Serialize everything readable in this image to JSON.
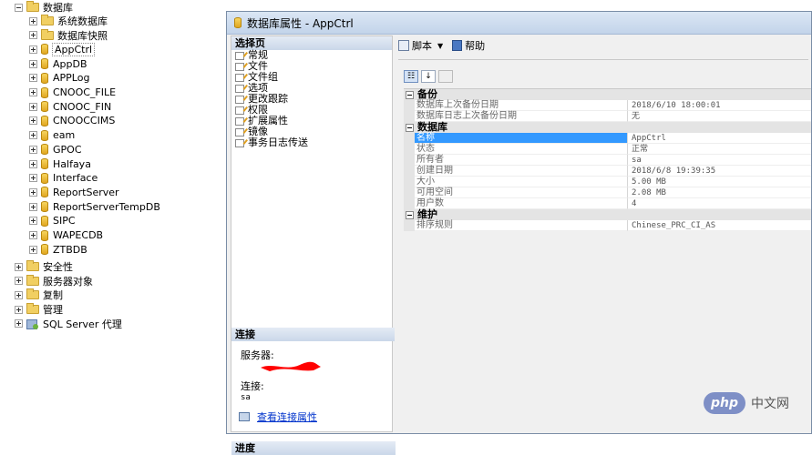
{
  "tree": {
    "root": {
      "label": "数据库",
      "expanded": true
    },
    "children": [
      {
        "label": "系统数据库",
        "icon": "folder-icon"
      },
      {
        "label": "数据库快照",
        "icon": "folder-icon"
      },
      {
        "label": "AppCtrl",
        "icon": "database-icon",
        "selected": true
      },
      {
        "label": "AppDB",
        "icon": "database-icon"
      },
      {
        "label": "APPLog",
        "icon": "database-icon"
      },
      {
        "label": "CNOOC_FILE",
        "icon": "database-icon"
      },
      {
        "label": "CNOOC_FIN",
        "icon": "database-icon"
      },
      {
        "label": "CNOOCCIMS",
        "icon": "database-icon"
      },
      {
        "label": "eam",
        "icon": "database-icon"
      },
      {
        "label": "GPOC",
        "icon": "database-icon"
      },
      {
        "label": "Halfaya",
        "icon": "database-icon"
      },
      {
        "label": "Interface",
        "icon": "database-icon"
      },
      {
        "label": "ReportServer",
        "icon": "database-icon"
      },
      {
        "label": "ReportServerTempDB",
        "icon": "database-icon"
      },
      {
        "label": "SIPC",
        "icon": "database-icon"
      },
      {
        "label": "WAPECDB",
        "icon": "database-icon"
      },
      {
        "label": "ZTBDB",
        "icon": "database-icon"
      }
    ],
    "top_level": [
      {
        "label": "安全性",
        "icon": "folder-icon"
      },
      {
        "label": "服务器对象",
        "icon": "folder-icon"
      },
      {
        "label": "复制",
        "icon": "folder-icon"
      },
      {
        "label": "管理",
        "icon": "folder-icon"
      },
      {
        "label": "SQL Server 代理",
        "icon": "sql-agent-icon"
      }
    ]
  },
  "dialog": {
    "title": "数据库属性 - AppCtrl",
    "select_page_header": "选择页",
    "pages": [
      "常规",
      "文件",
      "文件组",
      "选项",
      "更改跟踪",
      "权限",
      "扩展属性",
      "镜像",
      "事务日志传送"
    ],
    "connection": {
      "header": "连接",
      "server_label": "服务器:",
      "connection_label": "连接:",
      "connection_value": "sa",
      "view_link": "查看连接属性"
    },
    "progress_header": "进度",
    "toolbar": {
      "script_label": "脚本",
      "help_label": "帮助"
    },
    "grid": [
      {
        "category": "备份",
        "rows": [
          {
            "name": "数据库上次备份日期",
            "value": "2018/6/10 18:00:01"
          },
          {
            "name": "数据库日志上次备份日期",
            "value": "无"
          }
        ]
      },
      {
        "category": "数据库",
        "rows": [
          {
            "name": "名称",
            "value": "AppCtrl",
            "selected": true
          },
          {
            "name": "状态",
            "value": "正常"
          },
          {
            "name": "所有者",
            "value": "sa"
          },
          {
            "name": "创建日期",
            "value": "2018/6/8 19:39:35"
          },
          {
            "name": "大小",
            "value": "5.00 MB"
          },
          {
            "name": "可用空间",
            "value": "2.08 MB"
          },
          {
            "name": "用户数",
            "value": "4"
          }
        ]
      },
      {
        "category": "维护",
        "rows": [
          {
            "name": "排序规则",
            "value": "Chinese_PRC_CI_AS"
          }
        ]
      }
    ]
  },
  "watermark": {
    "logo": "php",
    "text": "中文网"
  },
  "colors": {
    "selection": "#3399ff",
    "link": "#0033cc",
    "redaction": "#ff0000"
  }
}
